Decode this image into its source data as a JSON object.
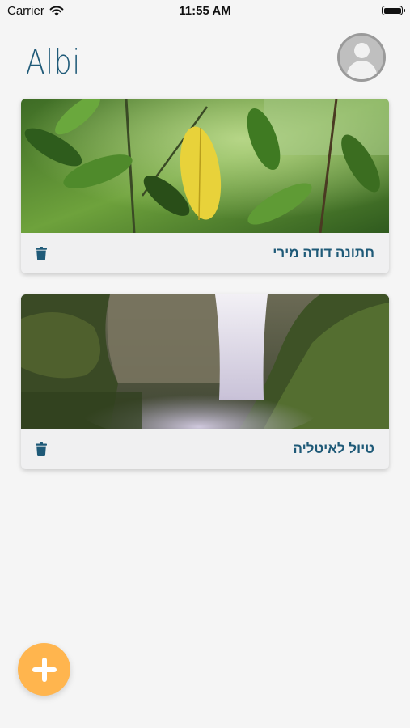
{
  "status_bar": {
    "carrier": "Carrier",
    "time": "11:55 AM"
  },
  "header": {
    "app_title": "Albi"
  },
  "albums": [
    {
      "title": "חתונה דודה מירי",
      "icon": "trash-icon"
    },
    {
      "title": "טיול לאיטליה",
      "icon": "trash-icon"
    }
  ],
  "colors": {
    "accent": "#1f5a78",
    "add_button": "#ffb54e",
    "background": "#f5f5f5"
  },
  "fab": {
    "icon": "plus-icon"
  }
}
